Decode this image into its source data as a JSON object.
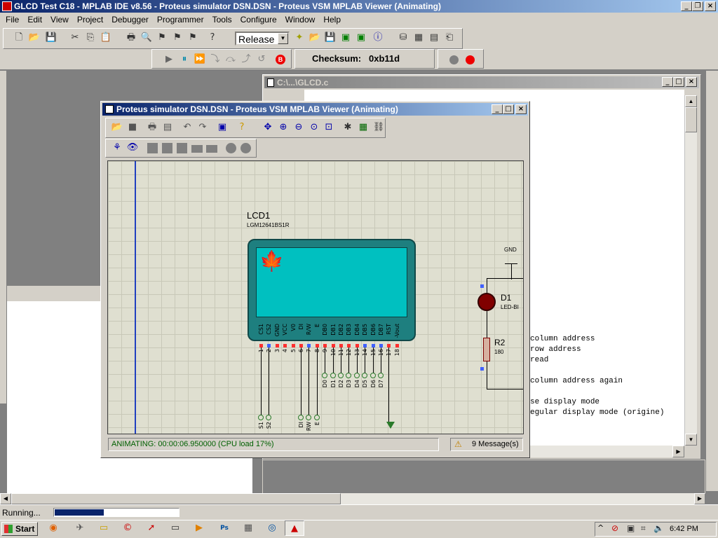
{
  "main_window": {
    "title": "GLCD Test C18 - MPLAB IDE v8.56 - Proteus simulator DSN.DSN - Proteus VSM MPLAB Viewer (Animating)",
    "minimize": "_",
    "maximize": "❐",
    "close": "×"
  },
  "menu": [
    "File",
    "Edit",
    "View",
    "Project",
    "Debugger",
    "Programmer",
    "Tools",
    "Configure",
    "Window",
    "Help"
  ],
  "toolbar": {
    "build_config": "Release",
    "checksum_label": "Checksum:",
    "checksum_value": "0xb11d"
  },
  "code_window": {
    "title": "C:\\...\\GLCD.c",
    "lines": [
      "column address",
      "row address",
      "read",
      "",
      "column address again",
      "",
      "se display mode",
      "egular display mode (origine)"
    ]
  },
  "proteus_window": {
    "title": "Proteus simulator DSN.DSN - Proteus VSM MPLAB Viewer (Animating)",
    "status": "ANIMATING: 00:00:06.950000 (CPU load 17%)",
    "messages": "9 Message(s)"
  },
  "schematic": {
    "lcd_ref": "LCD1",
    "lcd_part": "LGM12641BS1R",
    "lcd_pins": [
      "CS1",
      "CS2",
      "GND",
      "VCC",
      "V0",
      "DI",
      "R/W",
      "E",
      "DB0",
      "DB1",
      "DB2",
      "DB3",
      "DB4",
      "DB5",
      "DB6",
      "DB7",
      "RST",
      "-Vout"
    ],
    "pin_numbers": [
      "1",
      "2",
      "3",
      "4",
      "5",
      "6",
      "7",
      "8",
      "9",
      "10",
      "11",
      "12",
      "13",
      "14",
      "15",
      "16",
      "17",
      "18"
    ],
    "net_labels": [
      "S1",
      "S2",
      "DI",
      "RW",
      "E",
      "D0",
      "D1",
      "D2",
      "D3",
      "D4",
      "D5",
      "D6",
      "D7"
    ],
    "gnd_label": "GND",
    "d1_ref": "D1",
    "d1_part": "LED-BI",
    "r2_ref": "R2",
    "r2_value": "180"
  },
  "ide_status": {
    "text": "Running...",
    "progress": 0.4
  },
  "taskbar": {
    "start": "Start",
    "time": "6:42 PM"
  },
  "colors": {
    "title_active": "#0a246a",
    "lcd_body": "#1e7f7f",
    "lcd_screen": "#00c0c0",
    "progress": "#0a246a"
  }
}
